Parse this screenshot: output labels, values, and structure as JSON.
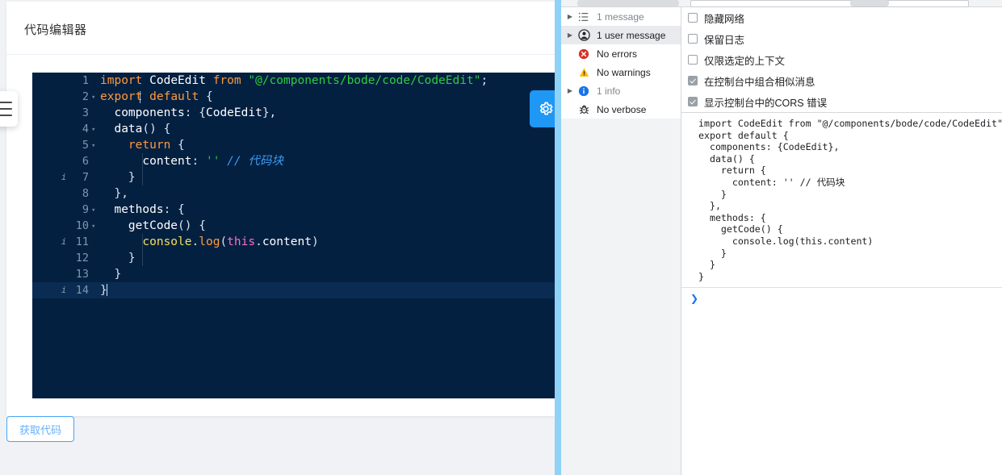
{
  "app": {
    "title": "代码编辑器",
    "hamburger_icon": "hamburger-menu-icon",
    "gear_icon": "gear-icon",
    "get_code_button": "获取代码",
    "accent_color": "#1f97f5",
    "editor_bg": "#042041",
    "page_bg": "#f0f2f5"
  },
  "editor": {
    "lines": [
      {
        "n": "1",
        "info": "",
        "fold": "",
        "active": false,
        "indent": 0
      },
      {
        "n": "2",
        "info": "",
        "fold": "▾",
        "active": false,
        "indent": 0
      },
      {
        "n": "3",
        "info": "",
        "fold": "",
        "active": false,
        "indent": 0
      },
      {
        "n": "4",
        "info": "",
        "fold": "▾",
        "active": false,
        "indent": 0
      },
      {
        "n": "5",
        "info": "",
        "fold": "▾",
        "active": false,
        "indent": 0
      },
      {
        "n": "6",
        "info": "",
        "fold": "",
        "active": false,
        "indent": 1
      },
      {
        "n": "7",
        "info": "i",
        "fold": "",
        "active": false,
        "indent": 1
      },
      {
        "n": "8",
        "info": "",
        "fold": "",
        "active": false,
        "indent": 0
      },
      {
        "n": "9",
        "info": "",
        "fold": "▾",
        "active": false,
        "indent": 0
      },
      {
        "n": "10",
        "info": "",
        "fold": "▾",
        "active": false,
        "indent": 0
      },
      {
        "n": "11",
        "info": "i",
        "fold": "",
        "active": false,
        "indent": 1
      },
      {
        "n": "12",
        "info": "",
        "fold": "",
        "active": false,
        "indent": 1
      },
      {
        "n": "13",
        "info": "",
        "fold": "",
        "active": false,
        "indent": 0
      },
      {
        "n": "14",
        "info": "i",
        "fold": "",
        "active": true,
        "indent": 0
      }
    ],
    "code_text": [
      "import CodeEdit from \"@/components/bode/code/CodeEdit\";",
      "export default {",
      "  components: {CodeEdit},",
      "  data() {",
      "    return {",
      "      content: '' // 代码块",
      "    }",
      "  },",
      "  methods: {",
      "    getCode() {",
      "      console.log(this.content)",
      "    }",
      "  }",
      "}"
    ],
    "token_colors": {
      "keyword": "#ff9a3c",
      "identifier": "#ffffff",
      "string": "#2ecc40",
      "comment": "#3b9bf0",
      "object": "#f1e05a",
      "this": "#ff6ec7"
    }
  },
  "devtools": {
    "sidebar": [
      {
        "label": "1 message",
        "icon": "list-icon",
        "disclosure": "▶",
        "selected": false,
        "muted": true
      },
      {
        "label": "1 user message",
        "icon": "person-icon",
        "disclosure": "▶",
        "selected": true,
        "muted": false
      },
      {
        "label": "No errors",
        "icon": "error-icon",
        "disclosure": "",
        "selected": false,
        "muted": false
      },
      {
        "label": "No warnings",
        "icon": "warning-icon",
        "disclosure": "",
        "selected": false,
        "muted": false
      },
      {
        "label": "1 info",
        "icon": "info-icon",
        "disclosure": "▶",
        "selected": false,
        "muted": true
      },
      {
        "label": "No verbose",
        "icon": "bug-icon",
        "disclosure": "",
        "selected": false,
        "muted": false
      }
    ],
    "settings": [
      {
        "label": "隐藏网络",
        "checked": false
      },
      {
        "label": "保留日志",
        "checked": false
      },
      {
        "label": "仅限选定的上下文",
        "checked": false
      },
      {
        "label": "在控制台中组合相似消息",
        "checked": true
      },
      {
        "label": "显示控制台中的CORS 错误",
        "checked": true
      }
    ],
    "console_output": [
      "import CodeEdit from \"@/components/bode/code/CodeEdit\";",
      "export default {",
      "  components: {CodeEdit},",
      "  data() {",
      "    return {",
      "      content: '' // 代码块",
      "    }",
      "  },",
      "  methods: {",
      "    getCode() {",
      "      console.log(this.content)",
      "    }",
      "  }",
      "}"
    ],
    "prompt_symbol": "❯"
  }
}
